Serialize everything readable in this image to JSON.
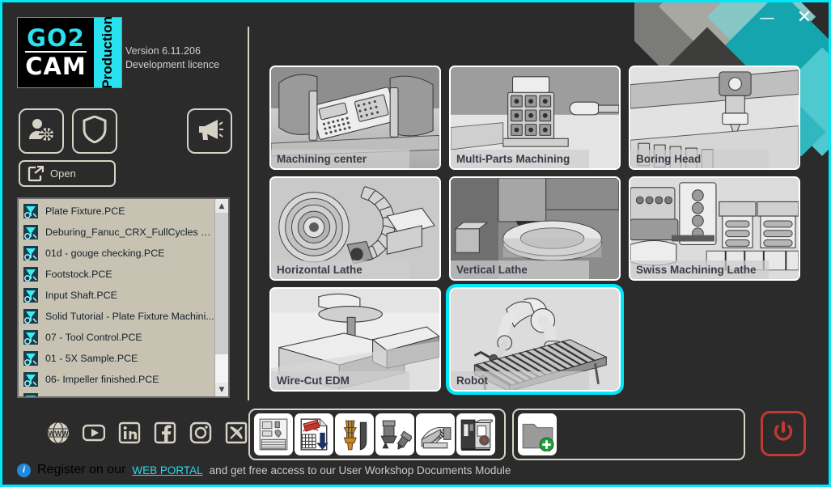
{
  "window": {
    "minimize_label": "—",
    "close_label": "✕",
    "accent_color": "#00e7f7",
    "background_color": "#2b2b2b"
  },
  "branding": {
    "logo_primary": "GO2",
    "logo_secondary": "CAM",
    "logo_edition": "Production",
    "version_line1": "Version 6.11.206",
    "version_line2": "Development licence",
    "logo_accent_color": "#28e2ef"
  },
  "actions": {
    "user_settings_icon": "user-settings-icon",
    "shield_icon": "shield-icon",
    "news_icon": "megaphone-icon",
    "open_label": "Open",
    "open_icon": "open-folder-arrow-icon"
  },
  "file_list": {
    "items": [
      {
        "name": "Plate Fixture.PCE"
      },
      {
        "name": "Deburing_Fanuc_CRX_FullCycles No ..."
      },
      {
        "name": "01d - gouge checking.PCE"
      },
      {
        "name": "Footstock.PCE"
      },
      {
        "name": "Input Shaft.PCE"
      },
      {
        "name": "Solid Tutorial - Plate Fixture Machini..."
      },
      {
        "name": "07 - Tool Control.PCE"
      },
      {
        "name": "01 - 5X Sample.PCE"
      },
      {
        "name": "06- Impeller finished.PCE"
      },
      {
        "name": ""
      }
    ],
    "scroll_up_label": "▲",
    "scroll_down_label": "▼",
    "background_color": "#c8c2b2"
  },
  "machine_tiles": [
    {
      "label": "Machining center",
      "art": "machining-center",
      "selected": false
    },
    {
      "label": "Multi-Parts Machining",
      "art": "multi-parts",
      "selected": false
    },
    {
      "label": "Boring Head",
      "art": "boring-head",
      "selected": false
    },
    {
      "label": "Horizontal Lathe",
      "art": "horizontal-lathe",
      "selected": false
    },
    {
      "label": "Vertical Lathe",
      "art": "vertical-lathe",
      "selected": false
    },
    {
      "label": "Swiss Machining Lathe",
      "art": "swiss-lathe",
      "selected": false
    },
    {
      "label": "Wire-Cut EDM",
      "art": "wire-cut-edm",
      "selected": false
    },
    {
      "label": "Robot",
      "art": "robot",
      "selected": true
    }
  ],
  "social_links": [
    {
      "icon": "www-globe-icon"
    },
    {
      "icon": "youtube-icon"
    },
    {
      "icon": "linkedin-icon"
    },
    {
      "icon": "facebook-icon"
    },
    {
      "icon": "instagram-icon"
    },
    {
      "icon": "x-logo-icon"
    }
  ],
  "toolbar_primary": [
    {
      "icon": "machine-cabinet-icon"
    },
    {
      "icon": "document-edit-icon"
    },
    {
      "icon": "tool-holder-icon"
    },
    {
      "icon": "tool-assembly-icon"
    },
    {
      "icon": "fixture-icon"
    },
    {
      "icon": "machine-simulation-icon"
    }
  ],
  "toolbar_secondary": [
    {
      "icon": "new-folder-icon"
    }
  ],
  "power": {
    "icon": "power-icon",
    "color": "#c03a30"
  },
  "footer": {
    "info_icon": "i",
    "text_before": "Register on our",
    "link_label": "WEB PORTAL",
    "text_after": "and get free access to our User Workshop Documents Module"
  }
}
